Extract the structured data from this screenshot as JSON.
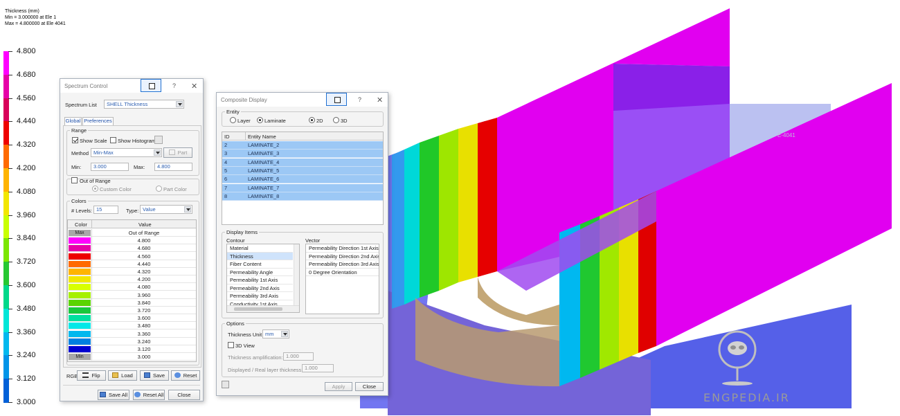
{
  "header": {
    "line1": "Thickness (mm)",
    "line2": "Min = 3.000000 at Ele 1",
    "line3": "Max = 4.800000 at Ele 4041"
  },
  "legend": {
    "labels": [
      "4.800",
      "4.680",
      "4.560",
      "4.440",
      "4.320",
      "4.200",
      "4.080",
      "3.960",
      "3.840",
      "3.720",
      "3.600",
      "3.480",
      "3.360",
      "3.240",
      "3.120",
      "3.000"
    ],
    "colors": [
      "#ff00ff",
      "#e600a8",
      "#d8005a",
      "#ee0000",
      "#ff6a00",
      "#ffb400",
      "#f2e600",
      "#c9ff00",
      "#7ce600",
      "#27c832",
      "#00d88a",
      "#00e6d8",
      "#00b8ee",
      "#0094e8",
      "#0060d8",
      "#0000d0"
    ]
  },
  "viewport": {
    "element_label": "E-4041",
    "brand": "ENGPEDIA.IR"
  },
  "spectrum_control": {
    "title": "Spectrum Control",
    "help": "?",
    "close": "✕",
    "spectrum_list_label": "Spectrum List",
    "spectrum_list_value": "SHELL Thickness",
    "tabs": [
      "Global",
      "Preferences"
    ],
    "range": {
      "title": "Range",
      "show_scale": "Show Scale",
      "show_histogram": "Show Histogram",
      "method_label": "Method",
      "method_value": "Min-Max",
      "part_button": "Part",
      "min_label": "Min:",
      "min_value": "3.000",
      "max_label": "Max:",
      "max_value": "4.800"
    },
    "out_of_range": {
      "label": "Out of Range",
      "custom_color": "Custom Color",
      "part_color": "Part Color"
    },
    "colors": {
      "title": "Colors",
      "levels_label": "# Levels:",
      "levels_value": "15",
      "type_label": "Type:",
      "type_value": "Value",
      "col_color": "Color",
      "col_value": "Value",
      "rows": [
        {
          "tag": "Max",
          "value": "Out of Range",
          "color": "#a8a8a8"
        },
        {
          "tag": "",
          "value": "4.800",
          "color": "#ff00ff"
        },
        {
          "tag": "",
          "value": "4.680",
          "color": "#e600a8"
        },
        {
          "tag": "",
          "value": "4.560",
          "color": "#ee0000"
        },
        {
          "tag": "",
          "value": "4.440",
          "color": "#ff6a00"
        },
        {
          "tag": "",
          "value": "4.320",
          "color": "#ffb400"
        },
        {
          "tag": "",
          "value": "4.200",
          "color": "#f2e600"
        },
        {
          "tag": "",
          "value": "4.080",
          "color": "#d8ff00"
        },
        {
          "tag": "",
          "value": "3.960",
          "color": "#a6f000"
        },
        {
          "tag": "",
          "value": "3.840",
          "color": "#5ad400"
        },
        {
          "tag": "",
          "value": "3.720",
          "color": "#19c83c"
        },
        {
          "tag": "",
          "value": "3.600",
          "color": "#00e0a0"
        },
        {
          "tag": "",
          "value": "3.480",
          "color": "#00e8e8"
        },
        {
          "tag": "",
          "value": "3.360",
          "color": "#00b8ee"
        },
        {
          "tag": "",
          "value": "3.240",
          "color": "#0080e0"
        },
        {
          "tag": "",
          "value": "3.120",
          "color": "#0000d0"
        },
        {
          "tag": "Min",
          "value": "3.000",
          "color": "#a8a8a8"
        }
      ]
    },
    "rgb_label": "RGB:",
    "flip": "Flip",
    "load": "Load",
    "save": "Save",
    "reset": "Reset",
    "save_all": "Save All",
    "reset_all": "Reset All",
    "close_button": "Close"
  },
  "composite_display": {
    "title": "Composite Display",
    "help": "?",
    "close": "✕",
    "entity": {
      "title": "Entity",
      "layer": "Layer",
      "laminate": "Laminate",
      "d2": "2D",
      "d3": "3D"
    },
    "table": {
      "col_id": "ID",
      "col_name": "Entity Name",
      "rows": [
        {
          "id": "2",
          "name": "LAMINATE_2"
        },
        {
          "id": "3",
          "name": "LAMINATE_3"
        },
        {
          "id": "4",
          "name": "LAMINATE_4"
        },
        {
          "id": "5",
          "name": "LAMINATE_5"
        },
        {
          "id": "6",
          "name": "LAMINATE_6"
        },
        {
          "id": "7",
          "name": "LAMINATE_7"
        },
        {
          "id": "8",
          "name": "LAMINATE_8"
        }
      ]
    },
    "display_items": {
      "title": "Display Items",
      "contour_label": "Contour",
      "vector_label": "Vector",
      "contour_items": [
        "Material",
        "Thickness",
        "Fiber Content",
        "Permeability Angle",
        "Permeability 1st Axis",
        "Permeability 2nd Axis",
        "Permeability 3rd Axis",
        "Conductivity 1st Axis"
      ],
      "vector_items": [
        "Permeability Direction 1st Axis",
        "Permeability Direction 2nd Axis",
        "Permeability Direction 3rd Axis",
        "0 Degree Orientation"
      ]
    },
    "options": {
      "title": "Options",
      "thickness_unit_label": "Thickness Unit",
      "thickness_unit_value": "mm",
      "view3d": "3D View",
      "amp_label": "Thickness amplification:",
      "amp_value": "1.000",
      "ratio_label": "Displayed / Real layer thickness:",
      "ratio_value": "1.000"
    },
    "apply": "Apply",
    "close_button": "Close"
  }
}
